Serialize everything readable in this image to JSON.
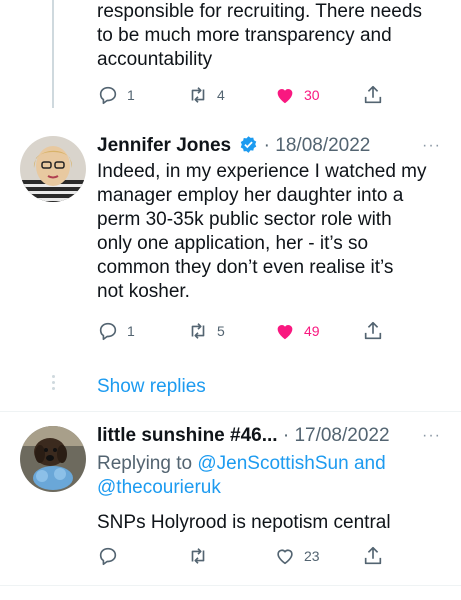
{
  "tweet_top": {
    "text_lines": [
      "responsible for recruiting. There needs",
      "to be much more transparency and",
      "accountability"
    ],
    "reply_count": "1",
    "retweet_count": "4",
    "like_count": "30"
  },
  "tweet_jennifer": {
    "name": "Jennifer Jones",
    "separator": "·",
    "date": "18/08/2022",
    "more": "···",
    "text_lines": [
      "Indeed, in my experience I watched my",
      "manager employ her daughter into a",
      "perm 30-35k public sector role with",
      "only one application, her - it’s so",
      "common they don’t even realise it’s",
      "not kosher."
    ],
    "reply_count": "1",
    "retweet_count": "5",
    "like_count": "49"
  },
  "show_replies": "Show replies",
  "tweet_sunshine": {
    "name": "little sunshine #46...",
    "separator": "·",
    "date": "17/08/2022",
    "more": "···",
    "replying_to_label": "Replying to",
    "mention_1": "@JenScottishSun",
    "and_label": "and",
    "mention_2": "@thecourieruk",
    "text": "SNPs Holyrood is nepotism central",
    "like_count": "23"
  },
  "colors": {
    "like_pink": "#f91880",
    "link_blue": "#1d9bf0",
    "muted_gray": "#536471"
  }
}
